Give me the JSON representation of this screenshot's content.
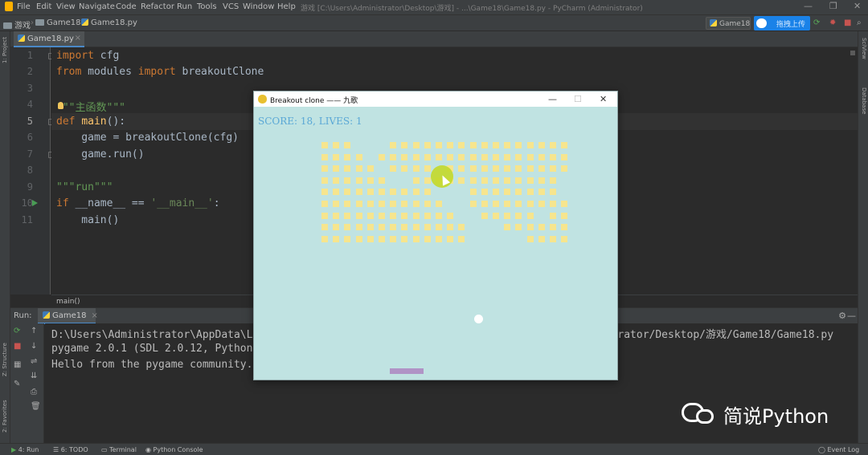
{
  "menubar": {
    "items": [
      "File",
      "Edit",
      "View",
      "Navigate",
      "Code",
      "Refactor",
      "Run",
      "Tools",
      "VCS",
      "Window",
      "Help"
    ],
    "window_title": "游戏 [C:\\Users\\Administrator\\Desktop\\游戏] - ...\\Game18\\Game18.py - PyCharm (Administrator)"
  },
  "navbar": {
    "crumbs": [
      "游戏",
      "Game18",
      "Game18.py"
    ],
    "run_config": "Game18",
    "baidu_label": "拖拽上传"
  },
  "editor_tab": {
    "label": "Game18.py"
  },
  "left_strip": {
    "project": "1: Project",
    "structure": "Z: Structure",
    "favorites": "2: Favorites"
  },
  "right_strip": {
    "sciview": "SciView",
    "database": "Database"
  },
  "code": {
    "line_numbers": [
      "1",
      "2",
      "3",
      "4",
      "5",
      "6",
      "7",
      "8",
      "9",
      "10",
      "11"
    ],
    "lines": [
      {
        "kw1": "import",
        "rest1": " cfg"
      },
      {
        "kw1": "from",
        "mid": " modules ",
        "kw2": "import",
        "rest1": " breakoutClone"
      },
      {
        "text": ""
      },
      {
        "q1": "\"\"\"",
        "cn": "主函数",
        "q2": "\"\"\""
      },
      {
        "kw1": "def",
        "sp": " ",
        "fn": "main",
        "rest1": "():"
      },
      {
        "text": "    game = breakoutClone(cfg)"
      },
      {
        "text": "    game.run()"
      },
      {
        "text": ""
      },
      {
        "doc": "\"\"\"run\"\"\""
      },
      {
        "kw1": "if",
        "mid": " __name__ == ",
        "str": "'__main__'",
        "rest1": ":"
      },
      {
        "text": "    main()"
      }
    ],
    "breadcrumb": "main()"
  },
  "run_panel": {
    "label": "Run:",
    "tab": "Game18",
    "console": [
      "D:\\Users\\Administrator\\AppData\\Local\\Programs\\Python\\Python37\\python.exe C:/Users/Administrator/Desktop/游戏/Game18/Game18.py",
      "pygame 2.0.1 (SDL 2.0.12, Python 3.7.0)",
      "Hello from the pygame community. https://www.pygame.org/contribute.html"
    ],
    "console_visible_tail": "strator/Desktop/游戏/Game18/Game18.py"
  },
  "game_window": {
    "title": "Breakout clone —— 九歌",
    "score_text": "SCORE: 18, LIVES: 1",
    "brick_color": "#f6e58e",
    "bg_color": "#c0e3e2"
  },
  "bottom_bar": {
    "run": "4: Run",
    "todo": "6: TODO",
    "terminal": "Terminal",
    "python_console": "Python Console",
    "event_log": "Event Log"
  },
  "watermark": {
    "text": "简说Python"
  }
}
